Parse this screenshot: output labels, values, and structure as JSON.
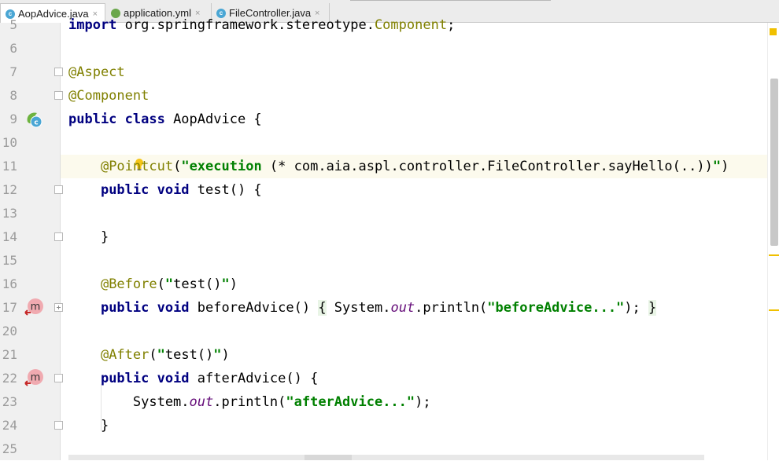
{
  "tabs": [
    {
      "label": "AopAdvice.java",
      "icon": "class-file-icon",
      "active": true
    },
    {
      "label": "application.yml",
      "icon": "yaml-file-icon",
      "active": false
    },
    {
      "label": "FileController.java",
      "icon": "class-file-icon",
      "active": false
    }
  ],
  "tab_close_glyph": "×",
  "colors": {
    "keyword": "#000080",
    "annotation": "#808000",
    "string": "#008000",
    "static_field": "#660e7a",
    "line_number": "#9b9b9b",
    "current_line": "#fcfaed",
    "scroll_marker": "#f0c000"
  },
  "editor": {
    "lines": [
      {
        "num": "5",
        "code": [
          {
            "t": "import",
            "c": "kw"
          },
          {
            "t": " org.springframework.stereotype.",
            "c": "plain"
          },
          {
            "t": "Component",
            "c": "ann"
          },
          {
            "t": ";",
            "c": "plain"
          }
        ]
      },
      {
        "num": "6",
        "code": []
      },
      {
        "num": "7",
        "fold": "open",
        "code": [
          {
            "t": "@Aspect",
            "c": "ann"
          }
        ]
      },
      {
        "num": "8",
        "fold": "open",
        "code": [
          {
            "t": "@Component",
            "c": "ann"
          }
        ]
      },
      {
        "num": "9",
        "gutter_icon": "spring-bean-icon",
        "code": [
          {
            "t": "public class ",
            "c": "kw"
          },
          {
            "t": "AopAdvice {",
            "c": "plain"
          }
        ]
      },
      {
        "num": "10",
        "code": []
      },
      {
        "num": "11",
        "highlight": true,
        "bulb": true,
        "code": [
          {
            "t": "    ",
            "c": "plain"
          },
          {
            "t": "@Pointcut",
            "c": "ann"
          },
          {
            "t": "(",
            "c": "plain"
          },
          {
            "t": "\"execution ",
            "c": "str"
          },
          {
            "t": "(* com.aia.aspl.controller.FileController.sayHello(..))",
            "c": "plain"
          },
          {
            "t": "\"",
            "c": "str"
          },
          {
            "t": ")",
            "c": "plain"
          }
        ]
      },
      {
        "num": "12",
        "fold": "open",
        "code": [
          {
            "t": "    ",
            "c": "plain"
          },
          {
            "t": "public void ",
            "c": "kw"
          },
          {
            "t": "test() {",
            "c": "plain"
          }
        ]
      },
      {
        "num": "13",
        "code": []
      },
      {
        "num": "14",
        "fold": "open",
        "code": [
          {
            "t": "    }",
            "c": "plain"
          }
        ]
      },
      {
        "num": "15",
        "code": []
      },
      {
        "num": "16",
        "code": [
          {
            "t": "    ",
            "c": "plain"
          },
          {
            "t": "@Before",
            "c": "ann"
          },
          {
            "t": "(",
            "c": "plain"
          },
          {
            "t": "\"",
            "c": "str"
          },
          {
            "t": "test()",
            "c": "plain"
          },
          {
            "t": "\"",
            "c": "str"
          },
          {
            "t": ")",
            "c": "plain"
          }
        ]
      },
      {
        "num": "17",
        "fold": "plus",
        "gutter_icon": "advice-method-icon",
        "code": [
          {
            "t": "    ",
            "c": "plain"
          },
          {
            "t": "public void ",
            "c": "kw"
          },
          {
            "t": "beforeAdvice() ",
            "c": "plain"
          },
          {
            "t": "{",
            "c": "plain brace-hl"
          },
          {
            "t": " System.",
            "c": "plain"
          },
          {
            "t": "out",
            "c": "fld"
          },
          {
            "t": ".println(",
            "c": "plain"
          },
          {
            "t": "\"beforeAdvice...\"",
            "c": "str"
          },
          {
            "t": "); ",
            "c": "plain"
          },
          {
            "t": "}",
            "c": "plain brace-hl"
          }
        ]
      },
      {
        "num": "20",
        "code": []
      },
      {
        "num": "21",
        "code": [
          {
            "t": "    ",
            "c": "plain"
          },
          {
            "t": "@After",
            "c": "ann"
          },
          {
            "t": "(",
            "c": "plain"
          },
          {
            "t": "\"",
            "c": "str"
          },
          {
            "t": "test()",
            "c": "plain"
          },
          {
            "t": "\"",
            "c": "str"
          },
          {
            "t": ")",
            "c": "plain"
          }
        ]
      },
      {
        "num": "22",
        "fold": "open",
        "gutter_icon": "advice-method-icon",
        "code": [
          {
            "t": "    ",
            "c": "plain"
          },
          {
            "t": "public void ",
            "c": "kw"
          },
          {
            "t": "afterAdvice() {",
            "c": "plain"
          }
        ]
      },
      {
        "num": "23",
        "code": [
          {
            "t": "        System.",
            "c": "plain"
          },
          {
            "t": "out",
            "c": "fld"
          },
          {
            "t": ".println(",
            "c": "plain"
          },
          {
            "t": "\"afterAdvice...\"",
            "c": "str"
          },
          {
            "t": ");",
            "c": "plain"
          }
        ]
      },
      {
        "num": "24",
        "fold": "open",
        "code": [
          {
            "t": "    }",
            "c": "plain"
          }
        ]
      },
      {
        "num": "25",
        "code": []
      }
    ]
  }
}
